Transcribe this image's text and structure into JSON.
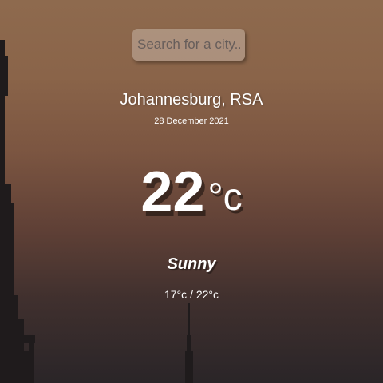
{
  "search": {
    "placeholder": "Search for a city...",
    "value": ""
  },
  "location": {
    "city": "Johannesburg, RSA",
    "date": "28 December 2021"
  },
  "weather": {
    "temperature": "22",
    "unit": "°c",
    "condition": "Sunny",
    "low_high": "17°c / 22°c"
  },
  "icons": {
    "background": "city-skyline-sunset-silhouette"
  },
  "colors": {
    "sky_top": "#8e6a4e",
    "sky_bottom": "#2a2528",
    "silhouette": "#1f1b1c",
    "text": "#ffffff"
  }
}
